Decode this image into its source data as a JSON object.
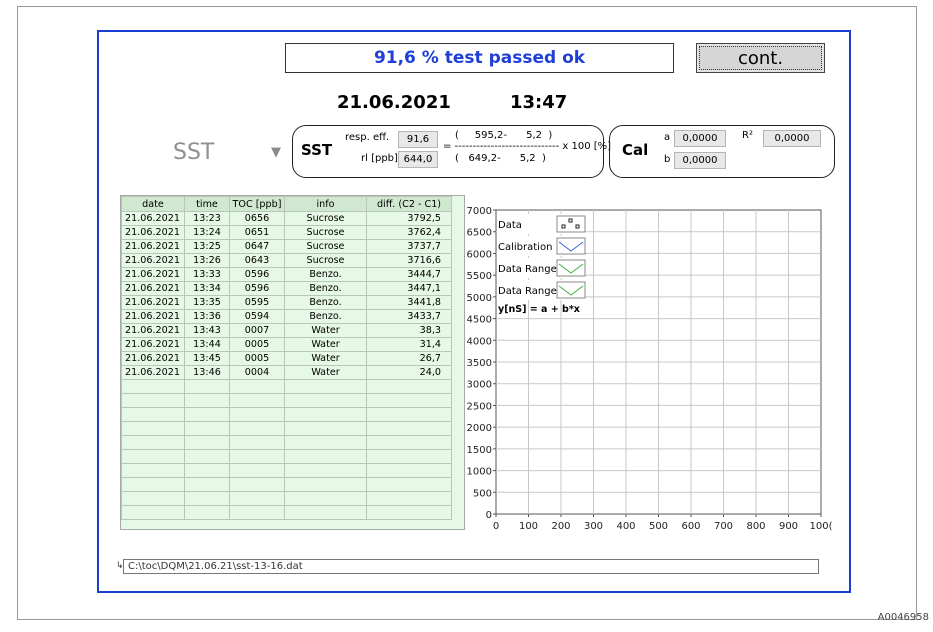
{
  "status": {
    "message": "91,6 % test passed ok"
  },
  "cont_button": {
    "label": "cont."
  },
  "datetime": {
    "date": "21.06.2021",
    "time": "13:47"
  },
  "mode_select": {
    "value": "SST"
  },
  "sst_panel": {
    "label": "SST",
    "resp_eff_label": "resp. eff.",
    "resp_eff_value": "91,6",
    "rl_label": "rl [ppb]",
    "rl_value": "644,0",
    "formula_top": "(     595,2-      5,2  )",
    "formula_mid": "= ----------------------------- x 100 [%]",
    "formula_bottom": "(   649,2-      5,2  )"
  },
  "cal_panel": {
    "label": "Cal",
    "a_label": "a",
    "a_value": "0,0000",
    "b_label": "b",
    "b_value": "0,0000",
    "r2_label": "R²",
    "r2_value": "0,0000"
  },
  "table": {
    "headers": [
      "date",
      "time",
      "TOC [ppb]",
      "info",
      "diff. (C2 - C1)"
    ],
    "rows": [
      [
        "21.06.2021",
        "13:23",
        "0656",
        "Sucrose",
        "3792,5"
      ],
      [
        "21.06.2021",
        "13:24",
        "0651",
        "Sucrose",
        "3762,4"
      ],
      [
        "21.06.2021",
        "13:25",
        "0647",
        "Sucrose",
        "3737,7"
      ],
      [
        "21.06.2021",
        "13:26",
        "0643",
        "Sucrose",
        "3716,6"
      ],
      [
        "21.06.2021",
        "13:33",
        "0596",
        "Benzo.",
        "3444,7"
      ],
      [
        "21.06.2021",
        "13:34",
        "0596",
        "Benzo.",
        "3447,1"
      ],
      [
        "21.06.2021",
        "13:35",
        "0595",
        "Benzo.",
        "3441,8"
      ],
      [
        "21.06.2021",
        "13:36",
        "0594",
        "Benzo.",
        "3433,7"
      ],
      [
        "21.06.2021",
        "13:43",
        "0007",
        "Water",
        "38,3"
      ],
      [
        "21.06.2021",
        "13:44",
        "0005",
        "Water",
        "31,4"
      ],
      [
        "21.06.2021",
        "13:45",
        "0005",
        "Water",
        "26,7"
      ],
      [
        "21.06.2021",
        "13:46",
        "0004",
        "Water",
        "24,0"
      ]
    ],
    "empty_rows": 10
  },
  "chart_data": {
    "type": "scatter",
    "x_ticks": [
      "0",
      "100",
      "200",
      "300",
      "400",
      "500",
      "600",
      "700",
      "800",
      "900",
      "100("
    ],
    "y_ticks": [
      "0",
      "500",
      "1000",
      "1500",
      "2000",
      "2500",
      "3000",
      "3500",
      "4000",
      "4500",
      "5000",
      "5500",
      "6000",
      "6500",
      "7000"
    ],
    "xlim": [
      0,
      1000
    ],
    "ylim": [
      0,
      7000
    ],
    "grid": true,
    "legend": [
      "Data",
      "Calibration",
      "Data Range",
      "Data Range"
    ],
    "legend_placement": "top-left",
    "equation": "y[nS] = a + b*x",
    "series": [],
    "colors": {
      "calibration": "#3a5fd8",
      "data_range": "#3fae3f"
    }
  },
  "file_path": "C:\\toc\\DQM\\21.06.21\\sst-13-16.dat",
  "figure_id": "A0046958"
}
